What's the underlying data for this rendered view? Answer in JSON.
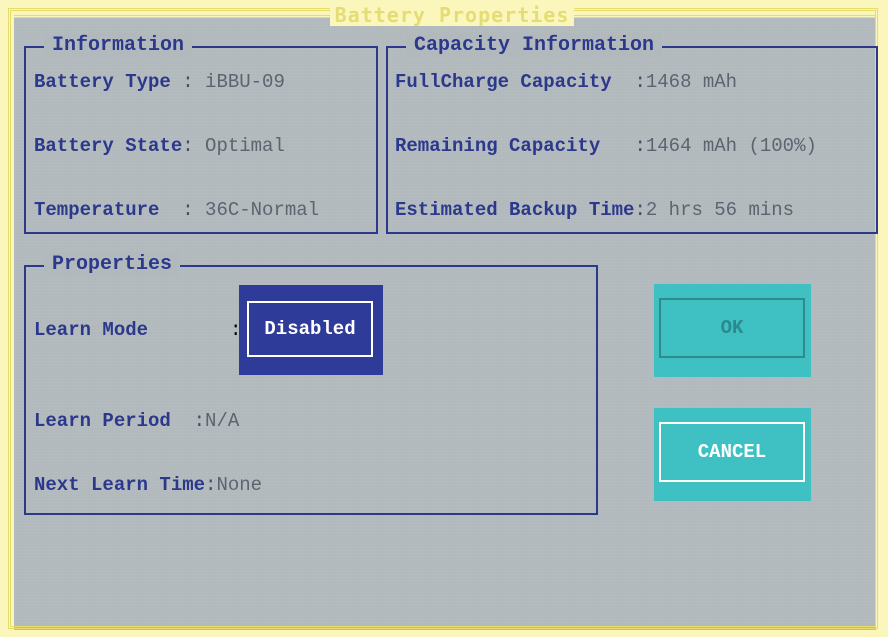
{
  "dialog": {
    "title": "Battery Properties"
  },
  "information": {
    "title": "Information",
    "rows": [
      {
        "label": "Battery Type ",
        "sep": ": ",
        "value": "iBBU-09"
      },
      {
        "label": "Battery State",
        "sep": ": ",
        "value": "Optimal"
      },
      {
        "label": "Temperature  ",
        "sep": ": ",
        "value": "36C-Normal"
      }
    ]
  },
  "capacity": {
    "title": "Capacity Information",
    "rows": [
      {
        "label": "FullCharge Capacity  ",
        "sep": ":",
        "value": "1468 mAh"
      },
      {
        "label": "Remaining Capacity   ",
        "sep": ":",
        "value": "1464 mAh (100%)"
      },
      {
        "label": "Estimated Backup Time",
        "sep": ":",
        "value": "2 hrs 56 mins"
      }
    ]
  },
  "properties": {
    "title": "Properties",
    "learn_mode": {
      "label": "Learn Mode",
      "sep": ":",
      "value": "Disabled"
    },
    "learn_period": {
      "label": "Learn Period  ",
      "sep": ":",
      "value": "N/A"
    },
    "next_learn_time": {
      "label": "Next Learn Time",
      "sep": ":",
      "value": "None"
    }
  },
  "buttons": {
    "ok": "OK",
    "cancel": "CANCEL"
  },
  "colors": {
    "background": "#b2b9bd",
    "frame": "#e6dc6c",
    "label": "#2c388c",
    "value": "#5c6470",
    "selected_button": "#2f3b98",
    "button": "#3fc0c2"
  }
}
